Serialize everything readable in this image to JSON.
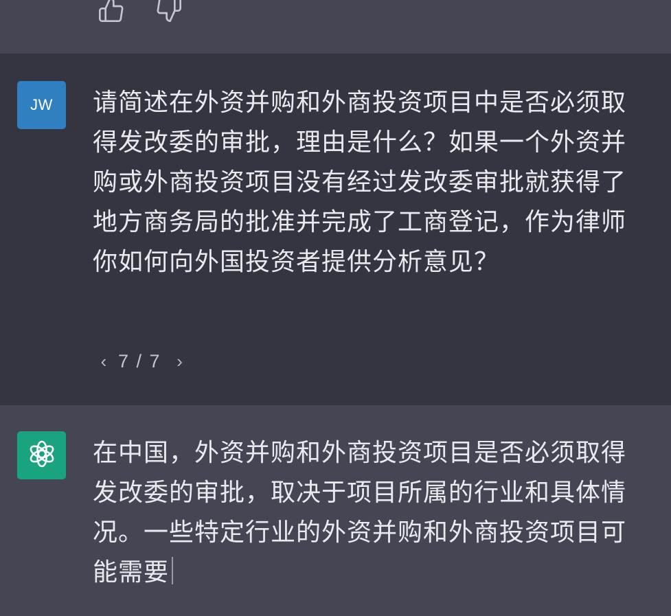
{
  "feedback": {
    "thumbs_up_icon": "thumbs-up-icon",
    "thumbs_down_icon": "thumbs-down-icon"
  },
  "user_message": {
    "avatar_initials": "JW",
    "avatar_color": "#2f7fc1",
    "text": "请简述在外资并购和外商投资项目中是否必须取得发改委的审批，理由是什么？如果一个外资并购或外商投资项目没有经过发改委审批就获得了地方商务局的批准并完成了工商登记，作为律师你如何向外国投资者提供分析意见？",
    "pager": {
      "prev_icon": "chevron-left-icon",
      "next_icon": "chevron-right-icon",
      "count": "7 / 7"
    }
  },
  "assistant_message": {
    "avatar_icon": "openai-logo-icon",
    "avatar_color": "#19a37f",
    "text": "在中国，外资并购和外商投资项目是否必须取得发改委的审批，取决于项目所属的行业和具体情况。一些特定行业的外资并购和外商投资项目可能需要"
  }
}
